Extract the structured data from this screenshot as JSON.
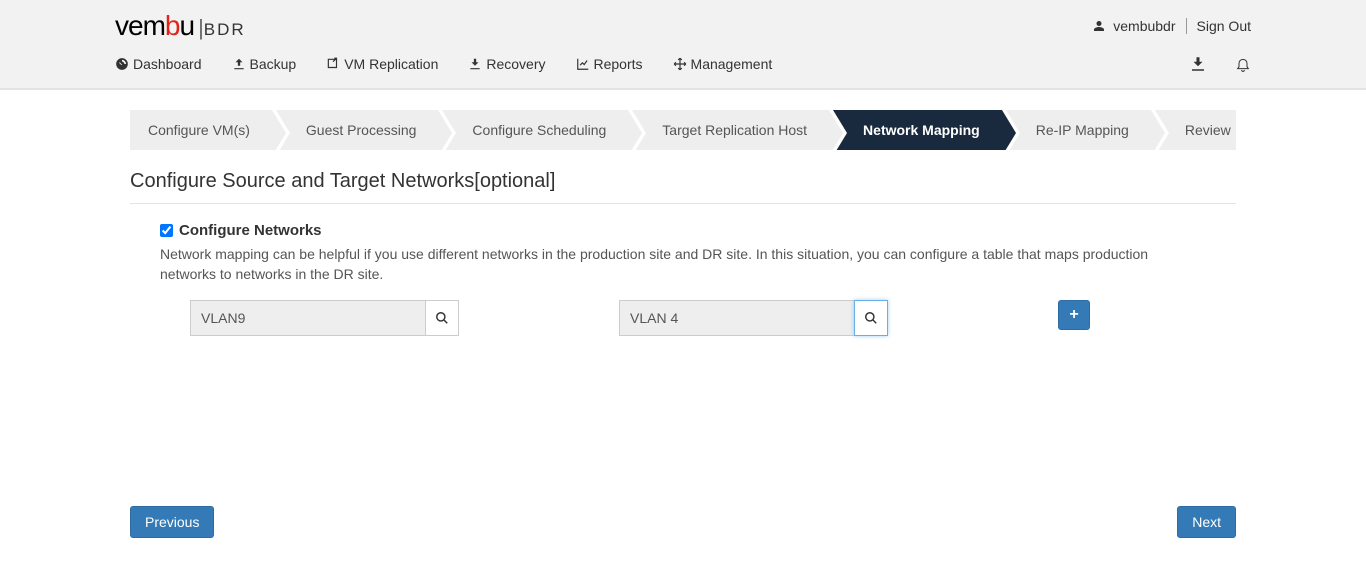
{
  "header": {
    "username": "vembubdr",
    "signout": "Sign Out"
  },
  "nav": {
    "dashboard": "Dashboard",
    "backup": "Backup",
    "vm_replication": "VM Replication",
    "recovery": "Recovery",
    "reports": "Reports",
    "management": "Management"
  },
  "wizard": {
    "steps": [
      "Configure VM(s)",
      "Guest Processing",
      "Configure Scheduling",
      "Target Replication Host",
      "Network Mapping",
      "Re-IP Mapping",
      "Review"
    ]
  },
  "section_title": "Configure Source and Target Networks[optional]",
  "config": {
    "checkbox_label": "Configure Networks",
    "checkbox_checked": true,
    "description": "Network mapping can be helpful if you use different networks in the production site and DR site. In this situation, you can configure a table that maps production networks to networks in the DR site.",
    "source_value": "VLAN9",
    "target_value": "VLAN 4"
  },
  "buttons": {
    "previous": "Previous",
    "next": "Next"
  }
}
